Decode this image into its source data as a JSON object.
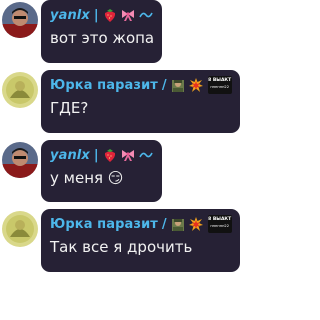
{
  "messages": [
    {
      "author": "yanlx",
      "separator": "|",
      "emojis": [
        "strawberry-icon",
        "ribbon-icon",
        "tilde-icon"
      ],
      "text": "вот это жопа"
    },
    {
      "author": "Юрка паразит",
      "separator": "/",
      "emojis": [
        "soldier-icon",
        "explosion-icon"
      ],
      "badge": {
        "line1": "8 ВЫАКТ",
        "line2": "нннннн22"
      },
      "text": "ГДЕ?"
    },
    {
      "author": "yanlx",
      "separator": "|",
      "emojis": [
        "strawberry-icon",
        "ribbon-icon",
        "tilde-icon"
      ],
      "text": "у меня 😏"
    },
    {
      "author": "Юрка паразит",
      "separator": "/",
      "emojis": [
        "soldier-icon",
        "explosion-icon"
      ],
      "badge": {
        "line1": "8 ВЫАКТ",
        "line2": "нннннн22"
      },
      "text": "Так все я дрочить"
    }
  ],
  "colors": {
    "bubble": "#262135",
    "name": "#4db7ea",
    "text": "#f2f2f2"
  }
}
